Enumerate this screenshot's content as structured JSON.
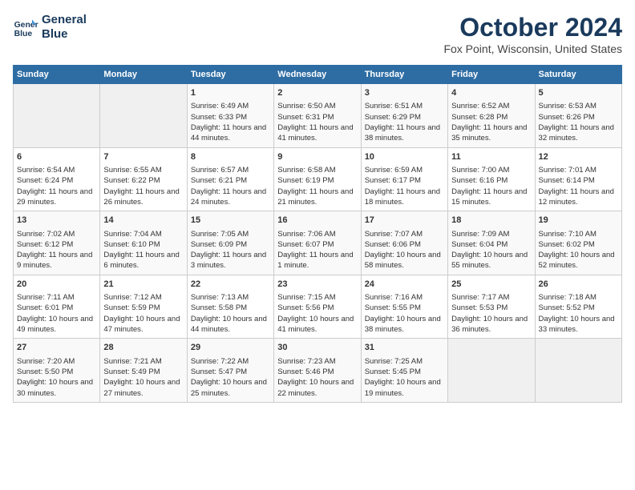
{
  "header": {
    "logo_line1": "General",
    "logo_line2": "Blue",
    "month_title": "October 2024",
    "location": "Fox Point, Wisconsin, United States"
  },
  "days_of_week": [
    "Sunday",
    "Monday",
    "Tuesday",
    "Wednesday",
    "Thursday",
    "Friday",
    "Saturday"
  ],
  "weeks": [
    [
      {
        "day": "",
        "info": ""
      },
      {
        "day": "",
        "info": ""
      },
      {
        "day": "1",
        "info": "Sunrise: 6:49 AM\nSunset: 6:33 PM\nDaylight: 11 hours and 44 minutes."
      },
      {
        "day": "2",
        "info": "Sunrise: 6:50 AM\nSunset: 6:31 PM\nDaylight: 11 hours and 41 minutes."
      },
      {
        "day": "3",
        "info": "Sunrise: 6:51 AM\nSunset: 6:29 PM\nDaylight: 11 hours and 38 minutes."
      },
      {
        "day": "4",
        "info": "Sunrise: 6:52 AM\nSunset: 6:28 PM\nDaylight: 11 hours and 35 minutes."
      },
      {
        "day": "5",
        "info": "Sunrise: 6:53 AM\nSunset: 6:26 PM\nDaylight: 11 hours and 32 minutes."
      }
    ],
    [
      {
        "day": "6",
        "info": "Sunrise: 6:54 AM\nSunset: 6:24 PM\nDaylight: 11 hours and 29 minutes."
      },
      {
        "day": "7",
        "info": "Sunrise: 6:55 AM\nSunset: 6:22 PM\nDaylight: 11 hours and 26 minutes."
      },
      {
        "day": "8",
        "info": "Sunrise: 6:57 AM\nSunset: 6:21 PM\nDaylight: 11 hours and 24 minutes."
      },
      {
        "day": "9",
        "info": "Sunrise: 6:58 AM\nSunset: 6:19 PM\nDaylight: 11 hours and 21 minutes."
      },
      {
        "day": "10",
        "info": "Sunrise: 6:59 AM\nSunset: 6:17 PM\nDaylight: 11 hours and 18 minutes."
      },
      {
        "day": "11",
        "info": "Sunrise: 7:00 AM\nSunset: 6:16 PM\nDaylight: 11 hours and 15 minutes."
      },
      {
        "day": "12",
        "info": "Sunrise: 7:01 AM\nSunset: 6:14 PM\nDaylight: 11 hours and 12 minutes."
      }
    ],
    [
      {
        "day": "13",
        "info": "Sunrise: 7:02 AM\nSunset: 6:12 PM\nDaylight: 11 hours and 9 minutes."
      },
      {
        "day": "14",
        "info": "Sunrise: 7:04 AM\nSunset: 6:10 PM\nDaylight: 11 hours and 6 minutes."
      },
      {
        "day": "15",
        "info": "Sunrise: 7:05 AM\nSunset: 6:09 PM\nDaylight: 11 hours and 3 minutes."
      },
      {
        "day": "16",
        "info": "Sunrise: 7:06 AM\nSunset: 6:07 PM\nDaylight: 11 hours and 1 minute."
      },
      {
        "day": "17",
        "info": "Sunrise: 7:07 AM\nSunset: 6:06 PM\nDaylight: 10 hours and 58 minutes."
      },
      {
        "day": "18",
        "info": "Sunrise: 7:09 AM\nSunset: 6:04 PM\nDaylight: 10 hours and 55 minutes."
      },
      {
        "day": "19",
        "info": "Sunrise: 7:10 AM\nSunset: 6:02 PM\nDaylight: 10 hours and 52 minutes."
      }
    ],
    [
      {
        "day": "20",
        "info": "Sunrise: 7:11 AM\nSunset: 6:01 PM\nDaylight: 10 hours and 49 minutes."
      },
      {
        "day": "21",
        "info": "Sunrise: 7:12 AM\nSunset: 5:59 PM\nDaylight: 10 hours and 47 minutes."
      },
      {
        "day": "22",
        "info": "Sunrise: 7:13 AM\nSunset: 5:58 PM\nDaylight: 10 hours and 44 minutes."
      },
      {
        "day": "23",
        "info": "Sunrise: 7:15 AM\nSunset: 5:56 PM\nDaylight: 10 hours and 41 minutes."
      },
      {
        "day": "24",
        "info": "Sunrise: 7:16 AM\nSunset: 5:55 PM\nDaylight: 10 hours and 38 minutes."
      },
      {
        "day": "25",
        "info": "Sunrise: 7:17 AM\nSunset: 5:53 PM\nDaylight: 10 hours and 36 minutes."
      },
      {
        "day": "26",
        "info": "Sunrise: 7:18 AM\nSunset: 5:52 PM\nDaylight: 10 hours and 33 minutes."
      }
    ],
    [
      {
        "day": "27",
        "info": "Sunrise: 7:20 AM\nSunset: 5:50 PM\nDaylight: 10 hours and 30 minutes."
      },
      {
        "day": "28",
        "info": "Sunrise: 7:21 AM\nSunset: 5:49 PM\nDaylight: 10 hours and 27 minutes."
      },
      {
        "day": "29",
        "info": "Sunrise: 7:22 AM\nSunset: 5:47 PM\nDaylight: 10 hours and 25 minutes."
      },
      {
        "day": "30",
        "info": "Sunrise: 7:23 AM\nSunset: 5:46 PM\nDaylight: 10 hours and 22 minutes."
      },
      {
        "day": "31",
        "info": "Sunrise: 7:25 AM\nSunset: 5:45 PM\nDaylight: 10 hours and 19 minutes."
      },
      {
        "day": "",
        "info": ""
      },
      {
        "day": "",
        "info": ""
      }
    ]
  ]
}
